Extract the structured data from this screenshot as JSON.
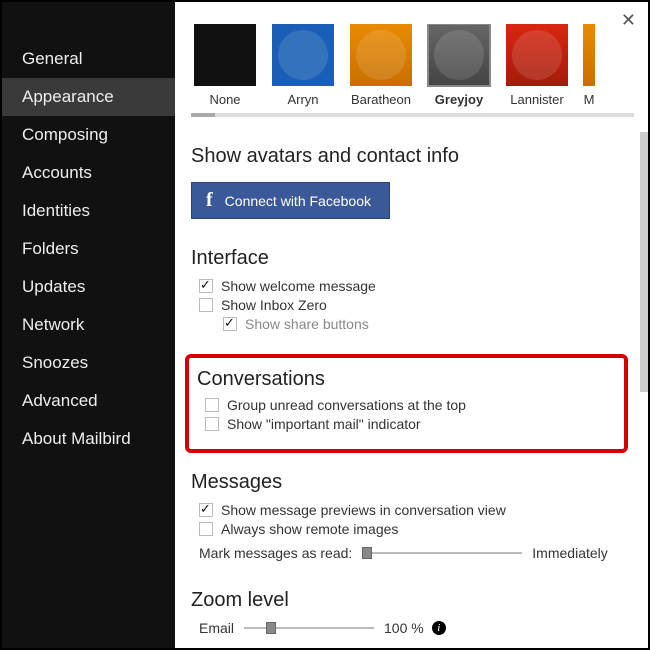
{
  "sidebar": {
    "items": [
      {
        "label": "General"
      },
      {
        "label": "Appearance",
        "active": true
      },
      {
        "label": "Composing"
      },
      {
        "label": "Accounts"
      },
      {
        "label": "Identities"
      },
      {
        "label": "Folders"
      },
      {
        "label": "Updates"
      },
      {
        "label": "Network"
      },
      {
        "label": "Snoozes"
      },
      {
        "label": "Advanced"
      },
      {
        "label": "About Mailbird"
      }
    ]
  },
  "themes": [
    {
      "label": "None"
    },
    {
      "label": "Arryn"
    },
    {
      "label": "Baratheon"
    },
    {
      "label": "Greyjoy",
      "selected": true
    },
    {
      "label": "Lannister"
    },
    {
      "label": "M"
    }
  ],
  "avatars": {
    "title": "Show avatars and contact info",
    "fb_label": "Connect with Facebook"
  },
  "interface": {
    "title": "Interface",
    "welcome": "Show welcome message",
    "inbox_zero": "Show Inbox Zero",
    "share": "Show share buttons"
  },
  "conversations": {
    "title": "Conversations",
    "group_unread": "Group unread conversations at the top",
    "important": "Show \"important mail\" indicator"
  },
  "messages": {
    "title": "Messages",
    "previews": "Show message previews in conversation view",
    "remote": "Always show remote images",
    "mark_label": "Mark messages as read:",
    "mark_value": "Immediately"
  },
  "zoom": {
    "title": "Zoom level",
    "email_label": "Email",
    "email_value": "100 %"
  }
}
